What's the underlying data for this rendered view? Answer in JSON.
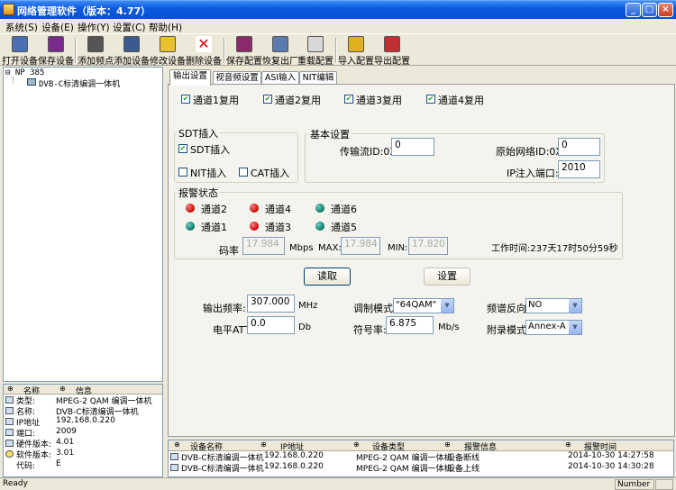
{
  "window": {
    "title": "网络管理软件（版本：4.77）",
    "min": "_",
    "max": "□",
    "close": "×"
  },
  "menu": [
    "系统(S)",
    "设备(E)",
    "操作(Y)",
    "设置(C)",
    "帮助(H)"
  ],
  "toolbar": [
    "打开设备",
    "保存设备",
    "添加频点",
    "添加设备",
    "修改设备",
    "删除设备",
    "保存配置",
    "恢复出厂",
    "重载配置",
    "导入配置",
    "导出配置"
  ],
  "tree": {
    "root": "NP 385",
    "child": "DVB-C标清编调一体机"
  },
  "info": {
    "headers": [
      "名称",
      "信息"
    ],
    "rows": [
      {
        "k": "类型:",
        "v": "MPEG-2 QAM 编调一体机"
      },
      {
        "k": "名称:",
        "v": "DVB-C标清编调一体机"
      },
      {
        "k": "IP地址",
        "v": "192.168.0.220"
      },
      {
        "k": "端口:",
        "v": "2009"
      },
      {
        "k": "硬件版本:",
        "v": "4.01"
      },
      {
        "k": "软件版本:",
        "v": "3.01"
      },
      {
        "k": "代码:",
        "v": "E"
      }
    ]
  },
  "tabs": [
    "输出设置",
    "视音频设置",
    "ASI输入",
    "NIT编辑"
  ],
  "channels_mux": [
    "通道1复用",
    "通道2复用",
    "通道3复用",
    "通道4复用"
  ],
  "sdt": {
    "title": "SDT插入",
    "sdt_insert": "SDT插入",
    "nit_insert": "NIT插入",
    "cat_insert": "CAT插入"
  },
  "basic": {
    "title": "基本设置",
    "ts_id_label": "传输流ID:0X",
    "ts_id": "0",
    "net_id_label": "原始网络ID:0X",
    "net_id": "0",
    "ip_port_label": "IP注入端口:",
    "ip_port": "2010"
  },
  "alarm": {
    "title": "报警状态",
    "channels": [
      {
        "label": "通道2",
        "color": "#d01010"
      },
      {
        "label": "通道4",
        "color": "#d01010"
      },
      {
        "label": "通道6",
        "color": "#108070"
      },
      {
        "label": "通道1",
        "color": "#108070"
      },
      {
        "label": "通道3",
        "color": "#d01010"
      },
      {
        "label": "通道5",
        "color": "#108070"
      }
    ],
    "rate_label": "码率",
    "rate": "17.984",
    "rate_unit": "Mbps",
    "max_label": "MAX:",
    "max": "17.984",
    "min_label": "MIN:",
    "min": "17.820",
    "uptime": "工作时间:237天17时50分59秒"
  },
  "buttons": {
    "read": "读取",
    "set": "设置"
  },
  "output": {
    "freq_label": "输出频率:",
    "freq": "307.000",
    "freq_unit": "MHz",
    "att_label": "电平ATT",
    "att": "0.0",
    "att_unit": "Db",
    "mod_label": "调制模式",
    "mod": "\"64QAM\"",
    "sym_label": "符号率:",
    "sym": "6.875",
    "sym_unit": "Mb/s",
    "spec_label": "频谱反向",
    "spec": "NO",
    "annex_label": "附录模式",
    "annex": "Annex-A"
  },
  "grid": {
    "headers": [
      "设备名称",
      "IP地址",
      "设备类型",
      "报警信息",
      "报警时间"
    ],
    "rows": [
      [
        "DVB-C标清编调一体机",
        "192.168.0.220",
        "MPEG-2 QAM 编调一体机",
        "设备断线",
        "2014-10-30 14:27:58"
      ],
      [
        "DVB-C标清编调一体机",
        "192.168.0.220",
        "MPEG-2 QAM 编调一体机",
        "设备上线",
        "2014-10-30 14:30:28"
      ]
    ]
  },
  "status": {
    "left": "Ready",
    "right": "Number"
  }
}
